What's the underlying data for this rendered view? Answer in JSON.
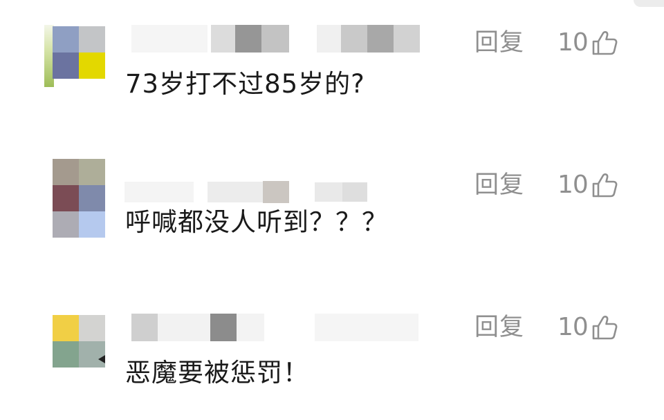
{
  "comments": [
    {
      "avatar_colors": [
        "#8f9fc3",
        "#c3c5c7",
        "#6b73a0",
        "#e3d800"
      ],
      "text": "73岁打不过85岁的?",
      "reply_label": "回复",
      "like_count": "10"
    },
    {
      "avatar_colors": [
        "#a49a8e",
        "#aeae99",
        "#7b4c55",
        "#7f8aab",
        "#adacb4",
        "#b5c9ee"
      ],
      "text": "呼喊都没人听到？？？",
      "reply_label": "回复",
      "like_count": "10"
    },
    {
      "avatar_colors": [
        "#f1cf45",
        "#d3d3d1",
        "#83a48e",
        "#a1b1ab"
      ],
      "text": "恶魔要被惩罚！",
      "reply_label": "回复",
      "like_count": "10"
    }
  ],
  "icons": {
    "like": "thumbs-up-icon"
  },
  "colors": {
    "secondary_text": "#8f8f8f",
    "primary_text": "#1a1a1a"
  }
}
